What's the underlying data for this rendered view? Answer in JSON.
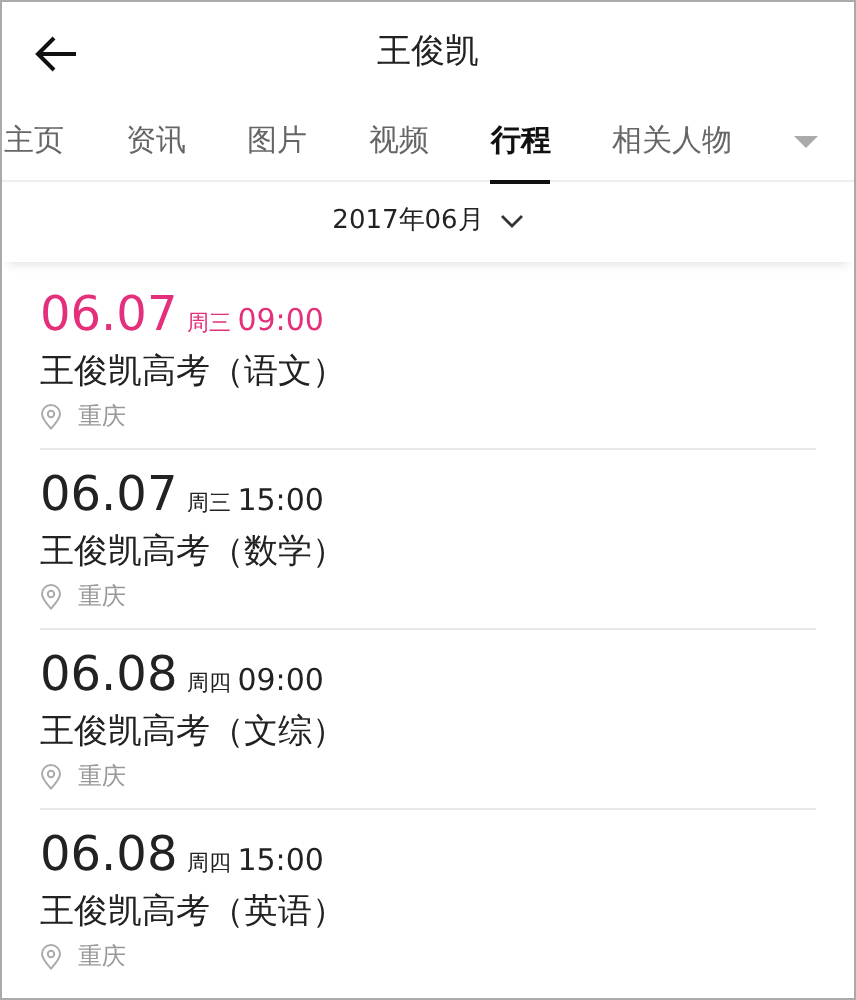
{
  "header": {
    "title": "王俊凯"
  },
  "tabs": [
    {
      "label": "主页",
      "selected": false
    },
    {
      "label": "资讯",
      "selected": false
    },
    {
      "label": "图片",
      "selected": false
    },
    {
      "label": "视频",
      "selected": false
    },
    {
      "label": "行程",
      "selected": true
    },
    {
      "label": "相关人物",
      "selected": false
    }
  ],
  "month_picker": {
    "label": "2017年06月"
  },
  "events": [
    {
      "date": "06.07",
      "weekday": "周三",
      "time": "09:00",
      "title": "王俊凯高考（语文）",
      "location": "重庆",
      "highlighted": true
    },
    {
      "date": "06.07",
      "weekday": "周三",
      "time": "15:00",
      "title": "王俊凯高考（数学）",
      "location": "重庆",
      "highlighted": false
    },
    {
      "date": "06.08",
      "weekday": "周四",
      "time": "09:00",
      "title": "王俊凯高考（文综）",
      "location": "重庆",
      "highlighted": false
    },
    {
      "date": "06.08",
      "weekday": "周四",
      "time": "15:00",
      "title": "王俊凯高考（英语）",
      "location": "重庆",
      "highlighted": false
    }
  ]
}
